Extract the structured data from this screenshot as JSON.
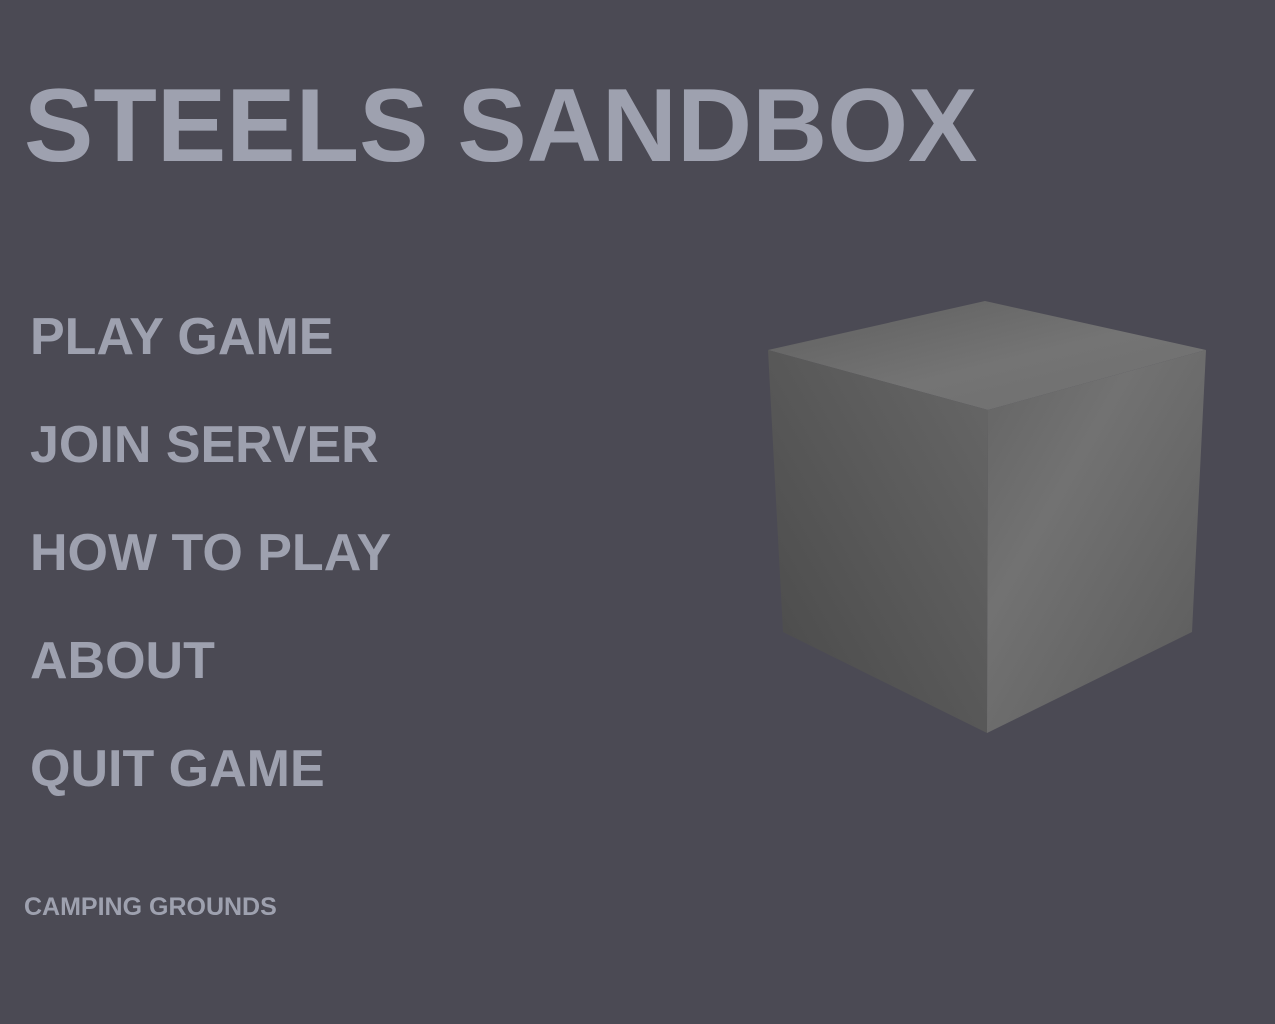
{
  "title": "STEELS SANDBOX",
  "menu": {
    "items": [
      {
        "id": "play-game",
        "label": "PLAY GAME"
      },
      {
        "id": "join-server",
        "label": "JOIN SERVER"
      },
      {
        "id": "how-to-play",
        "label": "HOW TO PLAY"
      },
      {
        "id": "about",
        "label": "ABOUT"
      },
      {
        "id": "quit-game",
        "label": "QUIT GAME"
      }
    ]
  },
  "footer": {
    "label": "CAMPING GROUNDS"
  },
  "colors": {
    "background": "#4b4a54",
    "text": "#9ea1af",
    "cube_top": "#666666",
    "cube_left": "#565656",
    "cube_right": "#6b6b6b"
  }
}
